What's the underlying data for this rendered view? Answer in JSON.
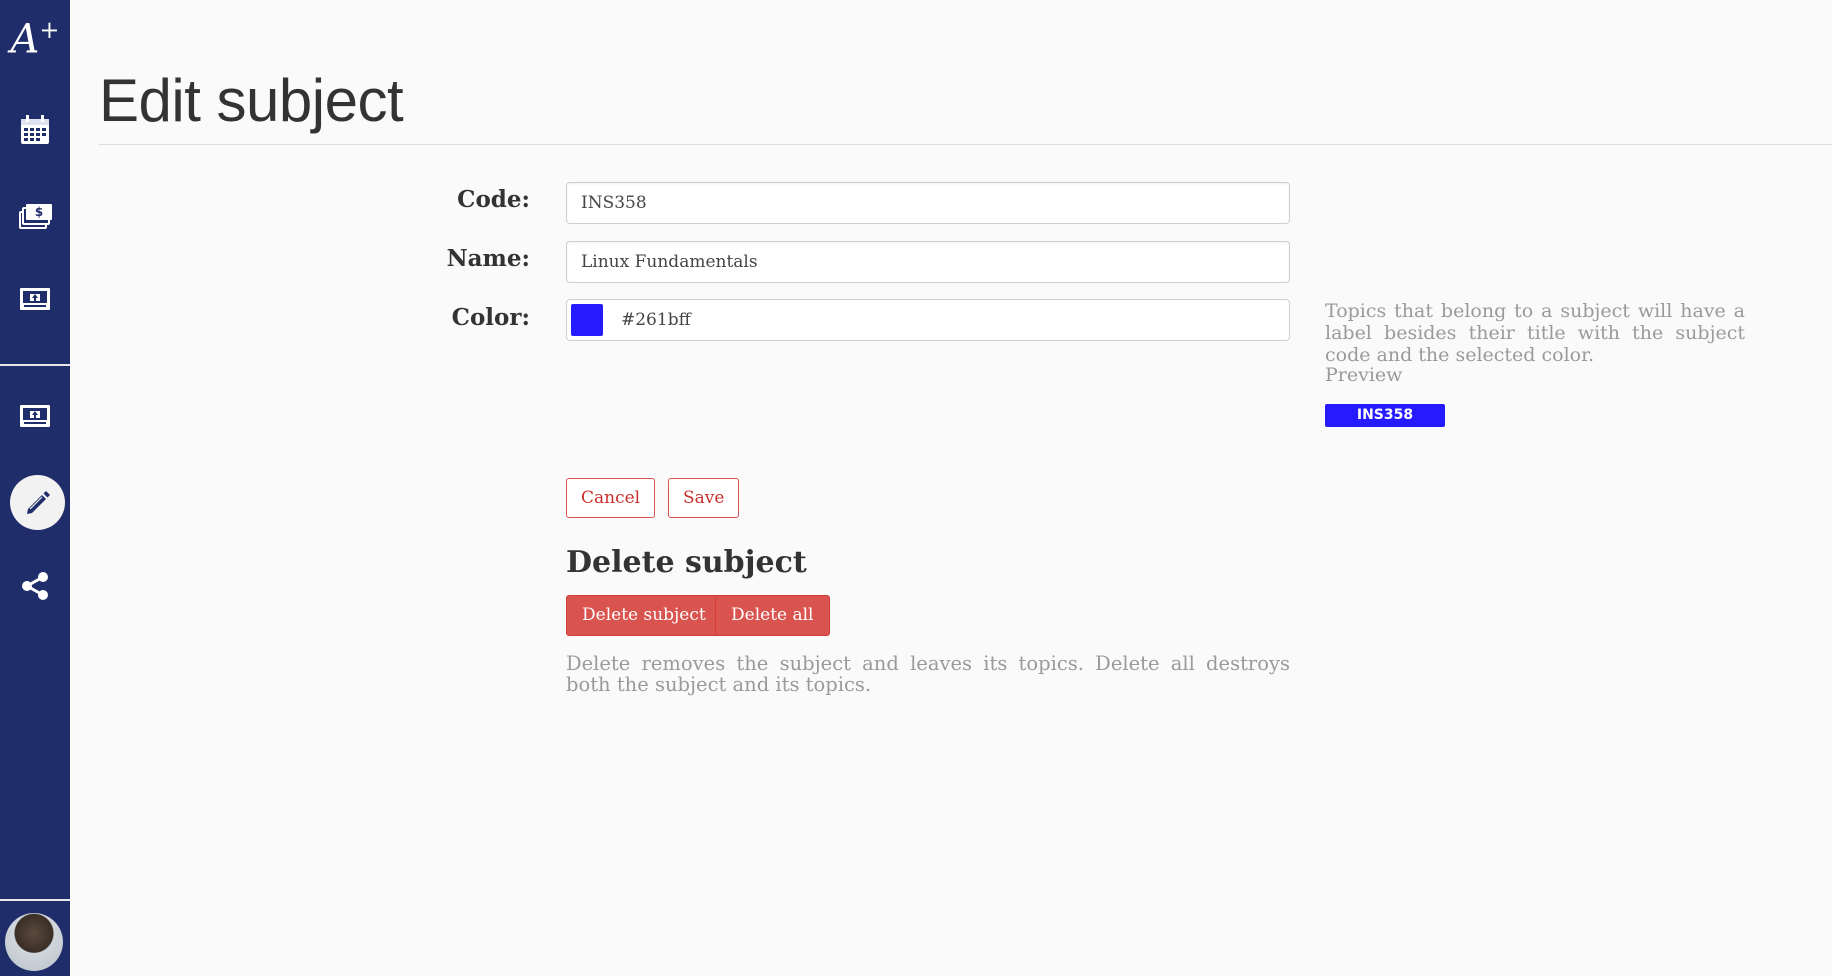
{
  "app": {
    "logo_text": "A",
    "logo_sup": "+"
  },
  "sidebar": {
    "items": [
      {
        "icon": "calendar-icon"
      },
      {
        "icon": "money-stack-icon"
      },
      {
        "icon": "upload-board-icon"
      },
      {
        "icon": "upload-board-icon"
      },
      {
        "icon": "pencil-icon",
        "active": true
      },
      {
        "icon": "share-icon"
      }
    ],
    "avatar": "user-avatar"
  },
  "page": {
    "title": "Edit subject"
  },
  "form": {
    "code": {
      "label": "Code:",
      "value": "INS358"
    },
    "name": {
      "label": "Name:",
      "value": "Linux Fundamentals"
    },
    "color": {
      "label": "Color:",
      "value": "#261bff"
    },
    "help": "Topics that belong to a subject will have a label besides their title with the subject code and the selected color.",
    "preview_label": "Preview",
    "preview_badge": "INS358",
    "cancel_label": "Cancel",
    "save_label": "Save"
  },
  "delete_section": {
    "title": "Delete subject",
    "delete_subject_label": "Delete subject",
    "delete_all_label": "Delete all",
    "help": "Delete removes the subject and leaves its topics. Delete all destroys both the subject and its topics."
  },
  "colors": {
    "sidebar": "#1f2d6b",
    "subject": "#261bff",
    "danger": "#d9534f"
  }
}
